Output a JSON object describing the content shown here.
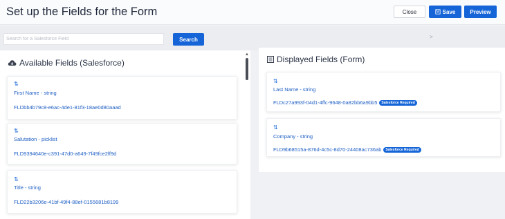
{
  "header": {
    "title": "Set up the Fields for the Form",
    "close_label": "Close",
    "save_label": "Save",
    "preview_label": "Preview"
  },
  "search": {
    "placeholder": "Search for a Salesforce Field",
    "value": "",
    "button_label": "Search",
    "arrow": ">"
  },
  "available": {
    "title": "Available Fields (Salesforce)",
    "fields": [
      {
        "name": "First Name - string",
        "id": "FLDbb4b79c8-e6ac-4de1-81f3-18ae0d80aaad"
      },
      {
        "name": "Salutation - picklist",
        "id": "FLD9394640e-c391-47d0-a649-7f49fce2ff9d"
      },
      {
        "name": "Title - string",
        "id": "FLD22b3206e-41bf-49f4-88ef-0155681b8199"
      }
    ]
  },
  "displayed": {
    "title": "Displayed Fields (Form)",
    "fields": [
      {
        "name": "Last Name - string",
        "id": "FLDc27a993f-04d1-4ffc-9648-0a82bb6a9bb5",
        "badge": "Salesforce Required"
      },
      {
        "name": "Company - string",
        "id": "FLD9b68515a-876d-4c5c-8d70-24408ac736ab",
        "badge": "Salesforce Required"
      }
    ]
  },
  "colors": {
    "primary": "#1565d8",
    "link": "#1f5fc4",
    "background": "#f0f1f4"
  },
  "icons": {
    "cloud": "cloud-icon",
    "list": "list-icon",
    "drag": "drag-handle-icon",
    "save": "save-icon"
  }
}
